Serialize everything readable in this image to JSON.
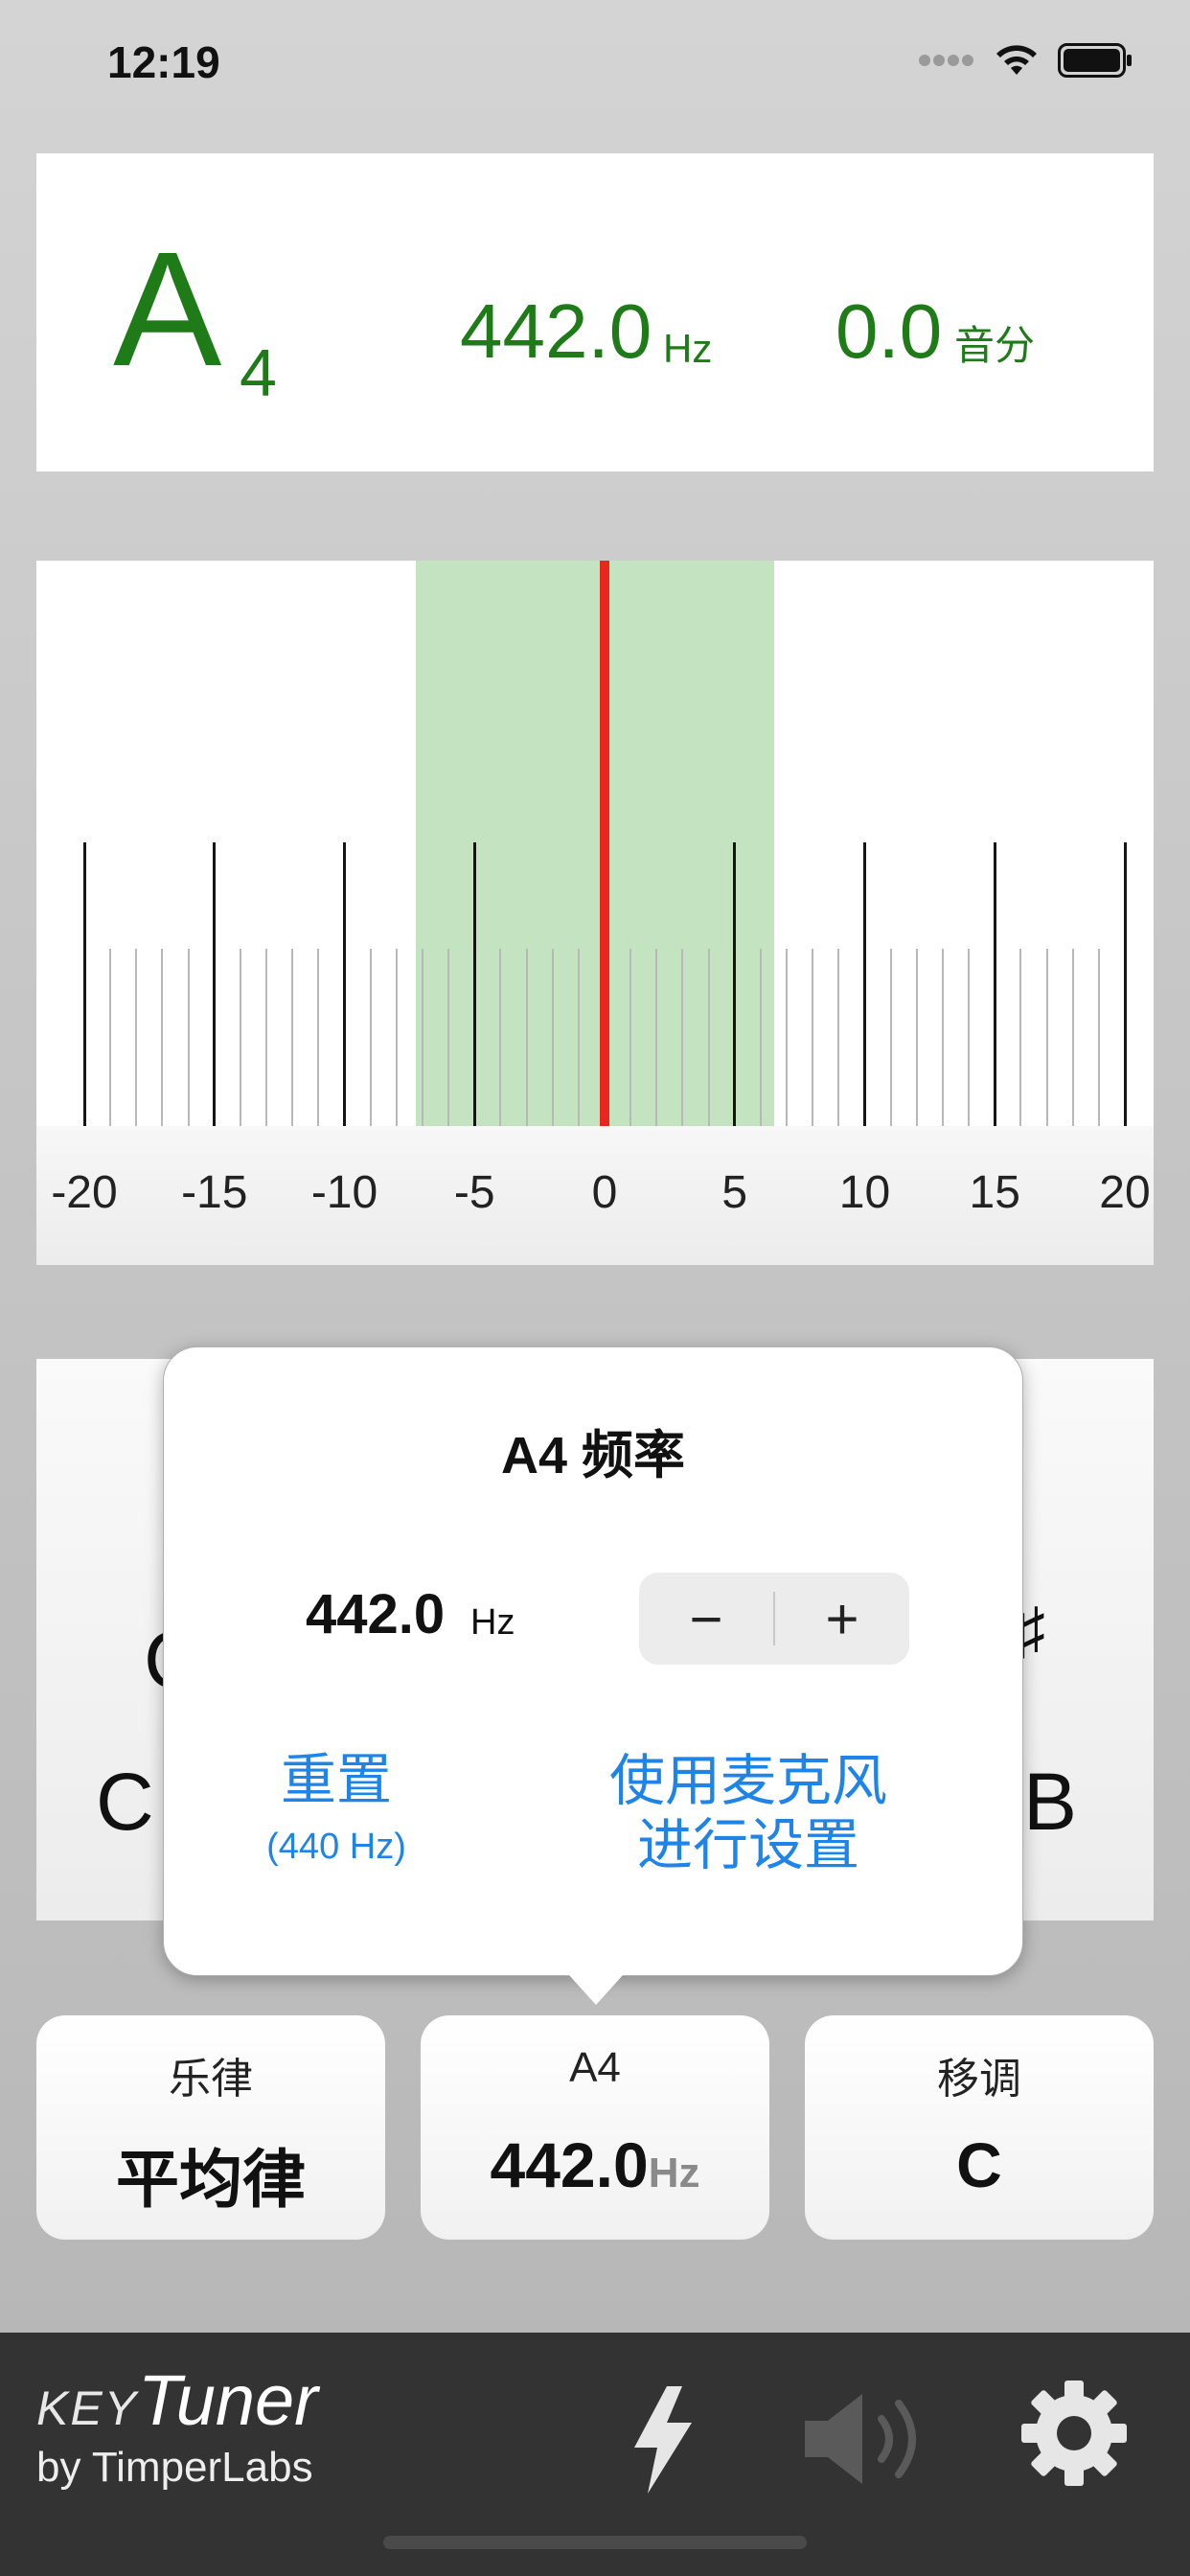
{
  "status_bar": {
    "time": "12:19"
  },
  "readout": {
    "note": "A",
    "octave": "4",
    "frequency": "442.0",
    "frequency_unit": "Hz",
    "cents": "0.0",
    "cents_unit": "音分",
    "color": "#1e7b18"
  },
  "meter": {
    "labels": [
      "-20",
      "-15",
      "-10",
      "-5",
      "0",
      "5",
      "10",
      "15",
      "20"
    ],
    "needle_value_cents": 0.0,
    "in_tune_zone_color": "#c4e4c1",
    "needle_color": "#e8281f"
  },
  "keyboard": {
    "left_key": "C",
    "left_key_upper": "C",
    "right_key": "B",
    "right_sharp": "♯"
  },
  "popover": {
    "title": "A4 频率",
    "frequency": "442.0",
    "frequency_unit": "Hz",
    "decrement": "−",
    "increment": "+",
    "reset_label": "重置",
    "reset_sub": "(440 Hz)",
    "mic_label_line1": "使用麦克风",
    "mic_label_line2": "进行设置",
    "accent": "#1f84e8"
  },
  "settings": {
    "temperament": {
      "title": "乐律",
      "value": "平均律"
    },
    "a4": {
      "title": "A4",
      "value": "442.0",
      "unit": "Hz"
    },
    "transpose": {
      "title": "移调",
      "value": "C"
    }
  },
  "footer": {
    "brand_key": "KEY",
    "brand_tuner": "Tuner",
    "brand_by": "by TimperLabs",
    "icons": [
      "lightning-icon",
      "speaker-icon",
      "gear-icon"
    ]
  }
}
